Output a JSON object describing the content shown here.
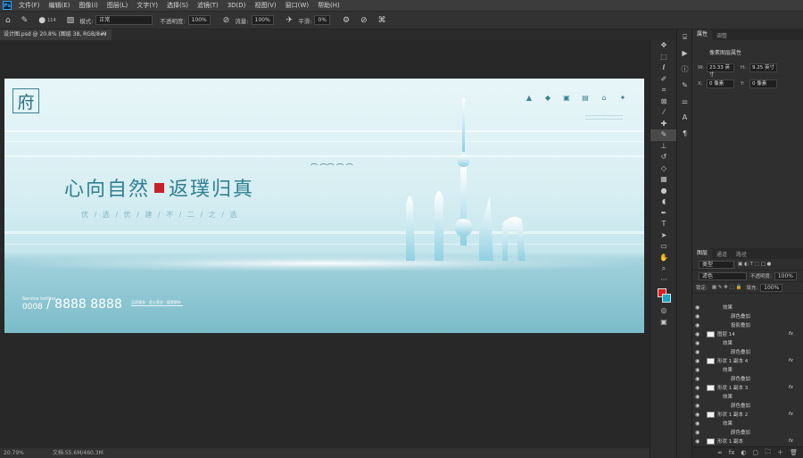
{
  "menubar": {
    "logo": "Ps",
    "items": [
      "文件(F)",
      "编辑(E)",
      "图像(I)",
      "图层(L)",
      "文字(Y)",
      "选择(S)",
      "滤镜(T)",
      "3D(D)",
      "视图(V)",
      "窗口(W)",
      "帮助(H)"
    ]
  },
  "options": {
    "brush_size": "114",
    "mode_label": "模式:",
    "mode_value": "正常",
    "opacity_label": "不透明度:",
    "opacity_value": "100%",
    "flow_label": "流量:",
    "flow_value": "100%",
    "smoothing_label": "平滑:",
    "smoothing_value": "0%"
  },
  "document_tab": {
    "title": "设计图.psd @ 20.8% (图层 38, RGB/8#)",
    "close": "×"
  },
  "status": {
    "zoom": "20.79%",
    "doc_size": "文档:55.6M/460.3M"
  },
  "artwork": {
    "logo_char": "府",
    "headline_left": "心向自然",
    "headline_right": "返璞归真",
    "subline": "优 / 选 / 优 / 建 / 不 / 二 / 之 / 选",
    "biz_label": "Service hotline",
    "phone_prefix": "0008",
    "phone": "/ 8888 8888",
    "caption": "品质服务 · 匠心营造 · 值得期待"
  },
  "properties": {
    "tabs": [
      "属性",
      "调整"
    ],
    "title": "像素图层属性",
    "w_label": "W:",
    "w_value": "23.33 英寸",
    "h_label": "H:",
    "h_value": "9.25 英寸",
    "x_label": "X:",
    "x_value": "0 像素",
    "y_label": "Y:",
    "y_value": "0 像素"
  },
  "layers_panel": {
    "tabs": [
      "图层",
      "通道",
      "路径"
    ],
    "kind_value": "类型",
    "blend_value": "滤色",
    "opacity_label": "不透明度:",
    "opacity_value": "100%",
    "lock_label": "锁定:",
    "fill_label": "填充:",
    "fill_value": "100%",
    "rows": [
      {
        "name": "效果",
        "indent": 2,
        "fx": ""
      },
      {
        "name": "颜色叠加",
        "indent": 3,
        "fx": ""
      },
      {
        "name": "投影叠加",
        "indent": 3,
        "fx": ""
      },
      {
        "name": "图层 14",
        "indent": 0,
        "fx": "fx"
      },
      {
        "name": "效果",
        "indent": 2,
        "fx": ""
      },
      {
        "name": "颜色叠加",
        "indent": 3,
        "fx": ""
      },
      {
        "name": "形状 1 副本 4",
        "indent": 0,
        "fx": "fx"
      },
      {
        "name": "效果",
        "indent": 2,
        "fx": ""
      },
      {
        "name": "颜色叠加",
        "indent": 3,
        "fx": ""
      },
      {
        "name": "形状 1 副本 3",
        "indent": 0,
        "fx": "fx"
      },
      {
        "name": "效果",
        "indent": 2,
        "fx": ""
      },
      {
        "name": "颜色叠加",
        "indent": 3,
        "fx": ""
      },
      {
        "name": "形状 1 副本 2",
        "indent": 0,
        "fx": "fx"
      },
      {
        "name": "效果",
        "indent": 2,
        "fx": ""
      },
      {
        "name": "颜色叠加",
        "indent": 3,
        "fx": ""
      },
      {
        "name": "形状 1 副本",
        "indent": 0,
        "fx": "fx"
      }
    ],
    "footer_icons": [
      "∞",
      "fx",
      "◐",
      "▢",
      "🗀",
      "＋",
      "🗑"
    ]
  },
  "colors": {
    "foreground": "#e01c1c",
    "background": "#1aa6c8"
  }
}
